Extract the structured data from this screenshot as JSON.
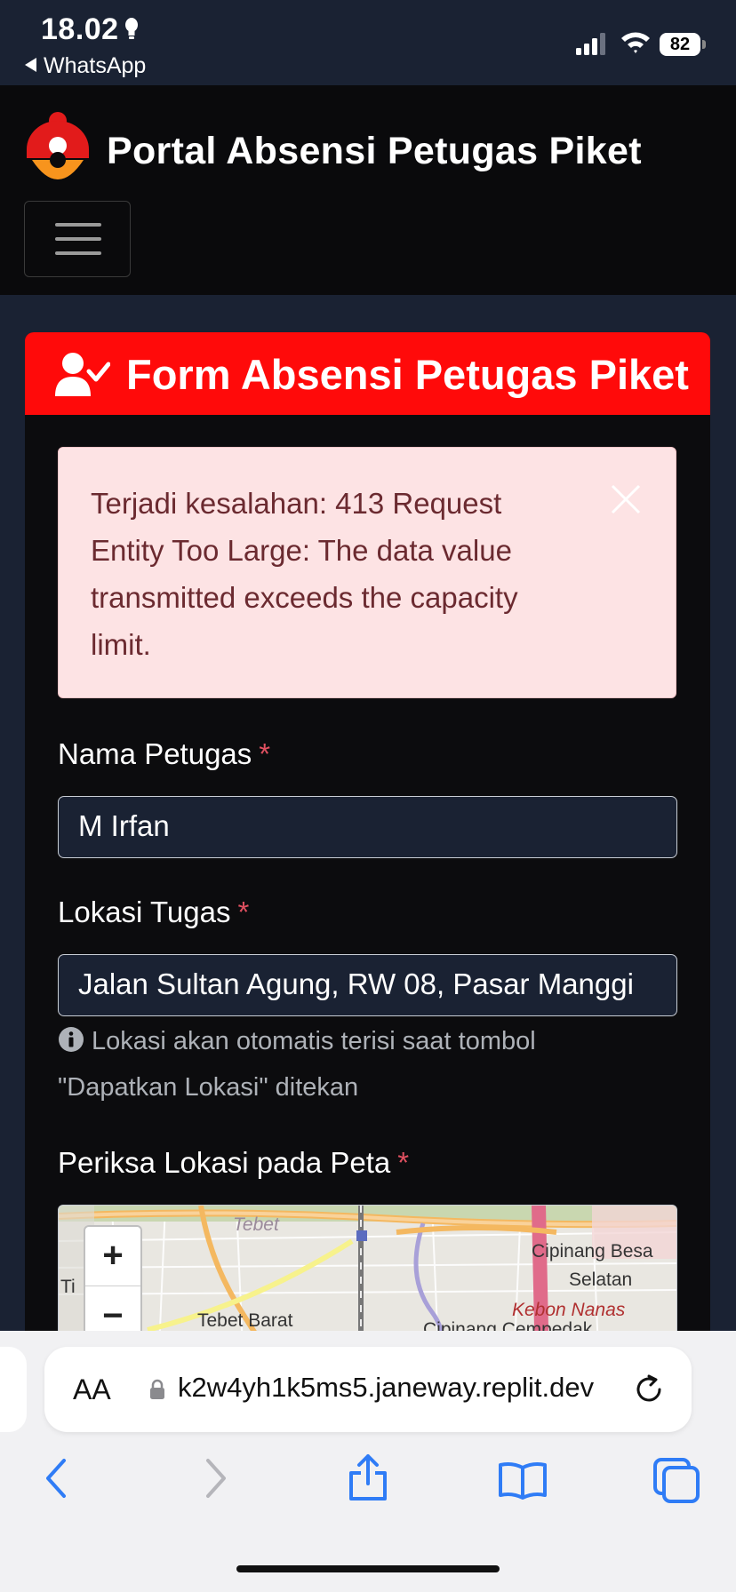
{
  "status_bar": {
    "time": "18.02",
    "back_app": "WhatsApp",
    "battery": "82"
  },
  "navbar": {
    "brand": "Portal Absensi Petugas Piket"
  },
  "card": {
    "title": "Form Absensi Petugas Piket",
    "alert": {
      "message": "Terjadi kesalahan: 413 Request Entity Too Large: The data value transmitted exceeds the capacity limit."
    },
    "fields": {
      "nama": {
        "label": "Nama Petugas",
        "required_mark": "*",
        "value": "M Irfan"
      },
      "lokasi": {
        "label": "Lokasi Tugas",
        "required_mark": "*",
        "value": "Jalan Sultan Agung, RW 08, Pasar Manggi"
      },
      "lokasi_help": "Lokasi akan otomatis terisi saat tombol \"Dapatkan Lokasi\" ditekan",
      "peta": {
        "label": "Periksa Lokasi pada Peta",
        "required_mark": "*"
      }
    },
    "map": {
      "zoom_in": "+",
      "zoom_out": "−",
      "labels": {
        "tebet": "Tebet",
        "tebet_barat": "Tebet Barat",
        "cipinang_besar": "Cipinang Besa",
        "selatan": "Selatan",
        "kebon_nanas": "Kebon Nanas",
        "cipinang_cempedak": "Cipinang Cempedak",
        "left_cut": "Ti"
      }
    }
  },
  "browser": {
    "aa_label": "AA",
    "url": "k2w4yh1k5ms5.janeway.replit.dev"
  },
  "colors": {
    "header_red": "#ff0a0a",
    "alert_bg": "#fde3e4",
    "page_bg": "#1a2233",
    "navbar_bg": "#0a0a0c",
    "safari_blue": "#2f7cf6"
  }
}
